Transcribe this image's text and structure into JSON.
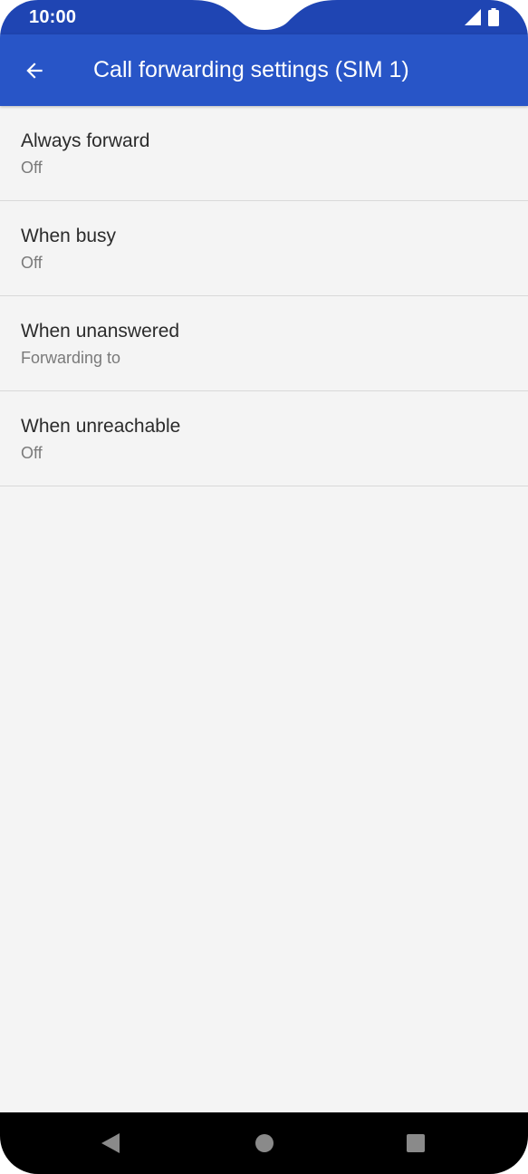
{
  "status_bar": {
    "time": "10:00",
    "icons": [
      "signal-icon",
      "battery-icon"
    ]
  },
  "app_bar": {
    "title": "Call forwarding settings (SIM 1)",
    "back_icon": "arrow-back-icon"
  },
  "settings": [
    {
      "title": "Always forward",
      "summary": "Off"
    },
    {
      "title": "When busy",
      "summary": "Off"
    },
    {
      "title": "When unanswered",
      "summary": "Forwarding to"
    },
    {
      "title": "When unreachable",
      "summary": "Off"
    }
  ],
  "nav_bar": {
    "buttons": [
      "back-triangle-icon",
      "home-circle-icon",
      "recents-square-icon"
    ]
  },
  "colors": {
    "status_bar": "#1f45b3",
    "app_bar": "#2855c7",
    "background": "#f4f4f4",
    "divider": "#d9d9d9",
    "nav_bar": "#000000"
  }
}
